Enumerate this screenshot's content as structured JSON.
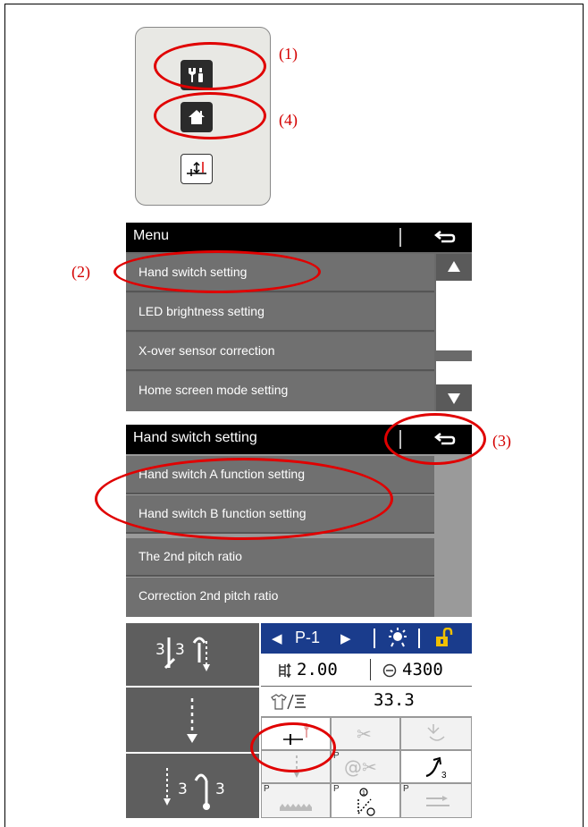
{
  "callouts": {
    "c1": "(1)",
    "c2": "(2)",
    "c3": "(3)",
    "c4": "(4)"
  },
  "menu_screen": {
    "title": "Menu",
    "items": [
      "Hand switch setting",
      "LED brightness setting",
      "X-over sensor correction",
      "Home screen mode setting"
    ]
  },
  "hand_switch_screen": {
    "title": "Hand switch setting",
    "items": [
      "Hand switch A function setting",
      "Hand switch B function setting",
      "The 2nd pitch ratio",
      "Correction 2nd pitch ratio"
    ]
  },
  "home_screen": {
    "pattern": "P-1",
    "stitch_length": "2.00",
    "speed": "4300",
    "pitch_ratio": "33.3",
    "left_panel": {
      "top_left": "3",
      "top_right": "3",
      "bottom_left": "3",
      "bottom_right": "3"
    },
    "p_marker": "P",
    "accent_color": "#1a3c8c",
    "lock_color": "#f0c000"
  },
  "keypad_icons": [
    "tools-icon",
    "home-icon",
    "needle-up-down-icon"
  ]
}
